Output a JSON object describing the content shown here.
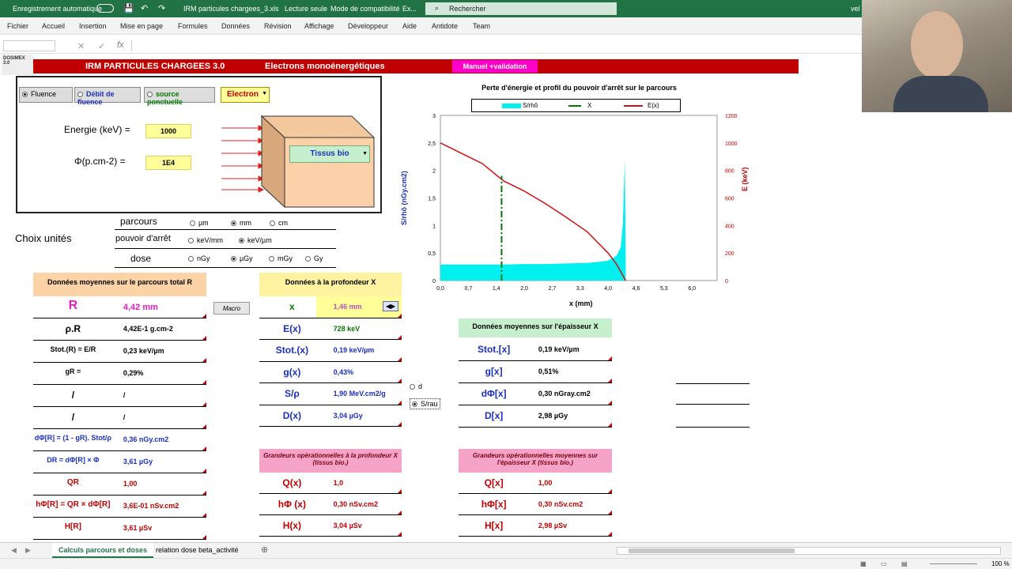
{
  "titlebar": {
    "autosave": "Enregistrement automatique",
    "filename": "IRM particules chargees_3.xls",
    "mode": "Lecture seule",
    "compat": "Mode de compatibilité",
    "extra": "Ex...",
    "search": "Rechercher",
    "user": "vel"
  },
  "menu": [
    "Fichier",
    "Accueil",
    "Insertion",
    "Mise en page",
    "Formules",
    "Données",
    "Révision",
    "Affichage",
    "Développeur",
    "Aide",
    "Antidote",
    "Team"
  ],
  "banner": {
    "logo": "DOSIMEX 3.0",
    "title": "IRM PARTICULES CHARGEES   3.0",
    "subtitle": "Electrons monoénergétiques",
    "manual": "Manuel +validation"
  },
  "mode": {
    "fluence": "Fluence",
    "debit": "Débit de fluence",
    "source": "source ponctuelle",
    "particle": "Electron"
  },
  "inputs": {
    "energy_label": "Energie (keV) =",
    "energy": "1000",
    "phi_label": "Φ(p.cm-2) =",
    "phi": "1E4",
    "material": "Tissus bio"
  },
  "units": {
    "title": "Choix  unités",
    "parcours": "parcours",
    "pouvoir": "pouvoir d'arrêt",
    "dose": "dose",
    "p_opts": [
      "µm",
      "mm",
      "cm"
    ],
    "s_opts": [
      "keV/mm",
      "keV/µm"
    ],
    "d_opts": [
      "nGy",
      "µGy",
      "mGy",
      "Gy"
    ]
  },
  "chart_data": {
    "type": "area",
    "title": "Perte d'énergie et profil du pouvoir d'arrêt sur le parcours",
    "legend": [
      "S/rhô",
      "X",
      "E(x)"
    ],
    "xlabel": "x (mm)",
    "ylabel": "S/rhô (nGy.cm2)",
    "y2label": "E (keV)",
    "x_ticks": [
      "0,0",
      "0,7",
      "1,4",
      "2,0",
      "2,7",
      "3,3",
      "4,0",
      "4,6",
      "5,3",
      "6,0"
    ],
    "y_ticks": [
      "0",
      "0,5",
      "1",
      "1,5",
      "2",
      "2,5",
      "3"
    ],
    "y2_ticks": [
      "0",
      "200",
      "400",
      "600",
      "800",
      "1000",
      "1200"
    ],
    "xlim": [
      0,
      6.6
    ],
    "ylim": [
      0,
      3
    ],
    "y2lim": [
      0,
      1200
    ],
    "marker_x": 1.46,
    "S": {
      "x": [
        0,
        0.5,
        1,
        1.5,
        2,
        2.5,
        3,
        3.5,
        4,
        4.2,
        4.3,
        4.35,
        4.4,
        4.42
      ],
      "y": [
        0.29,
        0.29,
        0.29,
        0.29,
        0.3,
        0.3,
        0.31,
        0.32,
        0.36,
        0.45,
        0.6,
        1.0,
        2.2,
        0.3
      ]
    },
    "E": {
      "x": [
        0,
        0.5,
        1,
        1.5,
        2,
        2.5,
        3,
        3.5,
        4,
        4.2,
        4.42
      ],
      "y": [
        1000,
        925,
        850,
        725,
        650,
        560,
        460,
        355,
        200,
        120,
        0
      ]
    }
  },
  "sec1": {
    "header": "Données moyennes sur le parcours total R",
    "macro": "Macro",
    "rows": [
      {
        "sym": "R",
        "val": "4,42 mm"
      },
      {
        "sym": "ρ.R",
        "val": "4,42E-1 g.cm-2"
      },
      {
        "sym": "Stot.(R) = E/R",
        "val": "0,23 keV/µm"
      },
      {
        "sym": "gR =",
        "val": "0,29%"
      },
      {
        "sym": "/",
        "val": "/"
      },
      {
        "sym": "/",
        "val": "/"
      },
      {
        "sym": "dΦ[R] = (1 - gR). Stot/ρ",
        "val": "0,36 nGy.cm2"
      },
      {
        "sym": "DR = dΦ[R] × Φ",
        "val": "3,61 µGy"
      },
      {
        "sym": "QR",
        "val": "1,00"
      },
      {
        "sym": "hΦ[R] = QR × dΦ[R]",
        "val": "3,6E-01 nSv.cm2"
      },
      {
        "sym": "H[R]",
        "val": "3,61 µSv"
      }
    ]
  },
  "sec2": {
    "header": "Données à la profondeur X",
    "rows": [
      {
        "sym": "x",
        "val": "1,46 mm"
      },
      {
        "sym": "E(x)",
        "val": "728 keV"
      },
      {
        "sym": "Stot.(x)",
        "val": "0,19 keV/µm"
      },
      {
        "sym": "g(x)",
        "val": "0,43%"
      },
      {
        "sym": "S/ρ",
        "val": "1,90 MeV.cm2/g"
      },
      {
        "sym": "D(x)",
        "val": "3,04 µGy"
      }
    ],
    "op_header": "Grandeurs opérationnelles  à la profondeur X (tissus bio.)",
    "op_rows": [
      {
        "sym": "Q(x)",
        "val": "1,0"
      },
      {
        "sym": "hΦ (x)",
        "val": "0,30 nSv.cm2"
      },
      {
        "sym": "H(x)",
        "val": "3,04 µSv"
      }
    ],
    "opt_d": "d",
    "opt_srau": "S/rau"
  },
  "sec3": {
    "header": "Données moyennes sur l'épaisseur X",
    "rows": [
      {
        "sym": "Stot.[x]",
        "val": "0,19 keV/µm"
      },
      {
        "sym": "g[x]",
        "val": "0,51%"
      },
      {
        "sym": "dΦ[x]",
        "val": "0,30 nGray.cm2"
      },
      {
        "sym": "D[x]",
        "val": "2,98 µGy"
      }
    ],
    "op_header": "Grandeurs opérationnelles  moyennes sur l'épaisseur X (tissus bio.)",
    "op_rows": [
      {
        "sym": "Q[x]",
        "val": "1,00"
      },
      {
        "sym": "hΦ[x]",
        "val": "0,30 nSv.cm2"
      },
      {
        "sym": "H[x]",
        "val": "2,98 µSv"
      }
    ]
  },
  "tabs": [
    "Calculs parcours et doses",
    "relation dose beta_activité"
  ],
  "status": {
    "zoom": "100 %"
  },
  "colors": {
    "excel": "#217346",
    "banner": "#c00000",
    "cyan": "#00f0f0",
    "curve": "#d01010"
  }
}
